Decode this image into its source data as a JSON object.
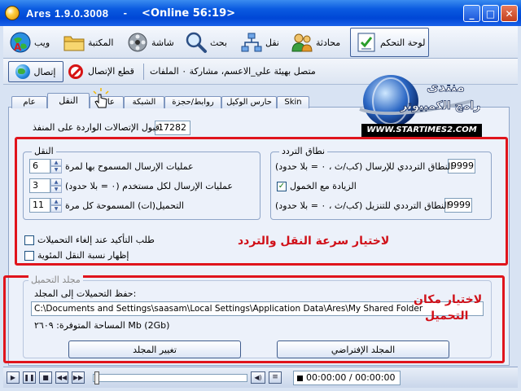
{
  "window": {
    "title": "Ares 1.9.0.3008",
    "separator": "-",
    "online": "<Online 56:19>",
    "min": "_",
    "max": "□",
    "close": "✕"
  },
  "toolbar": {
    "control_panel": "لوحة التحكم",
    "chat": "محادثة",
    "transfer": "نقل",
    "search": "بحث",
    "screen": "شاشة",
    "library": "المكتبة",
    "web": "ويب"
  },
  "connbar": {
    "connect": "إتصال",
    "disconnect": "قطع الإتصال",
    "status": "متصل بهيئة علي_الاعسم، مشاركة ٠ الملفات"
  },
  "logo": {
    "line1": "منتدى",
    "line2": "برامج الكمبيوتر",
    "url": "WWW.STARTIMES2.COM"
  },
  "tabs": [
    "Skin",
    "حارس الوكيل",
    "روابط/حجزة",
    "الشبكة",
    "عامة",
    "النقل",
    "عام"
  ],
  "ports": {
    "label": "قبول الإتصالات الواردة على المنفذ:",
    "value": "17282"
  },
  "transfer_group": {
    "title": "النقل",
    "rows": [
      {
        "label": "عمليات الإرسال المسموح بها لمرة",
        "value": "6"
      },
      {
        "label": "عمليات الإرسال لكل مستخدم (٠ = بلا حدود)",
        "value": "3"
      },
      {
        "label": "التحميل(ات) المسموحة كل مرة",
        "value": "11"
      }
    ]
  },
  "bandwidth_group": {
    "title": "نطاق التردد",
    "upload_label": "النطاق الترددي للإرسال (كب/ث ، ٠ = بلا حدود)",
    "upload_value": "9999",
    "idle_label": "الزيادة مع الخمول",
    "idle_checked": "✓",
    "download_label": "النطاق الترددي للتنزيل (كب/ث ، ٠ = بلا حدود)",
    "download_value": "9999"
  },
  "options": {
    "confirm_cancel": "طلب التأكيد عند إلغاء التحميلات",
    "show_percent": "إظهار نسبة النقل المئوية"
  },
  "annotation1": "لاختيار سرعة النقل والتردد",
  "download_group": {
    "title": "مجلد التحميل",
    "save_label": "حفظ التحميلات إلى المجلد:",
    "path": "C:\\Documents and Settings\\saasam\\Local Settings\\Application Data\\Ares\\My Shared Folder",
    "space": "المساحة المتوفرة: ٢٦٠٩ Mb (2Gb)",
    "change_btn": "تغيير المجلد",
    "default_btn": "المجلد الإفتراضي"
  },
  "annotation2_line1": "لاختيار مكان",
  "annotation2_line2": "التحميل",
  "player": {
    "time": "00:00:00 / 00:00:00"
  },
  "colors": {
    "titlebar": "#0a5ae0",
    "annotation": "#e0141c",
    "panel": "#ecf1fa"
  }
}
